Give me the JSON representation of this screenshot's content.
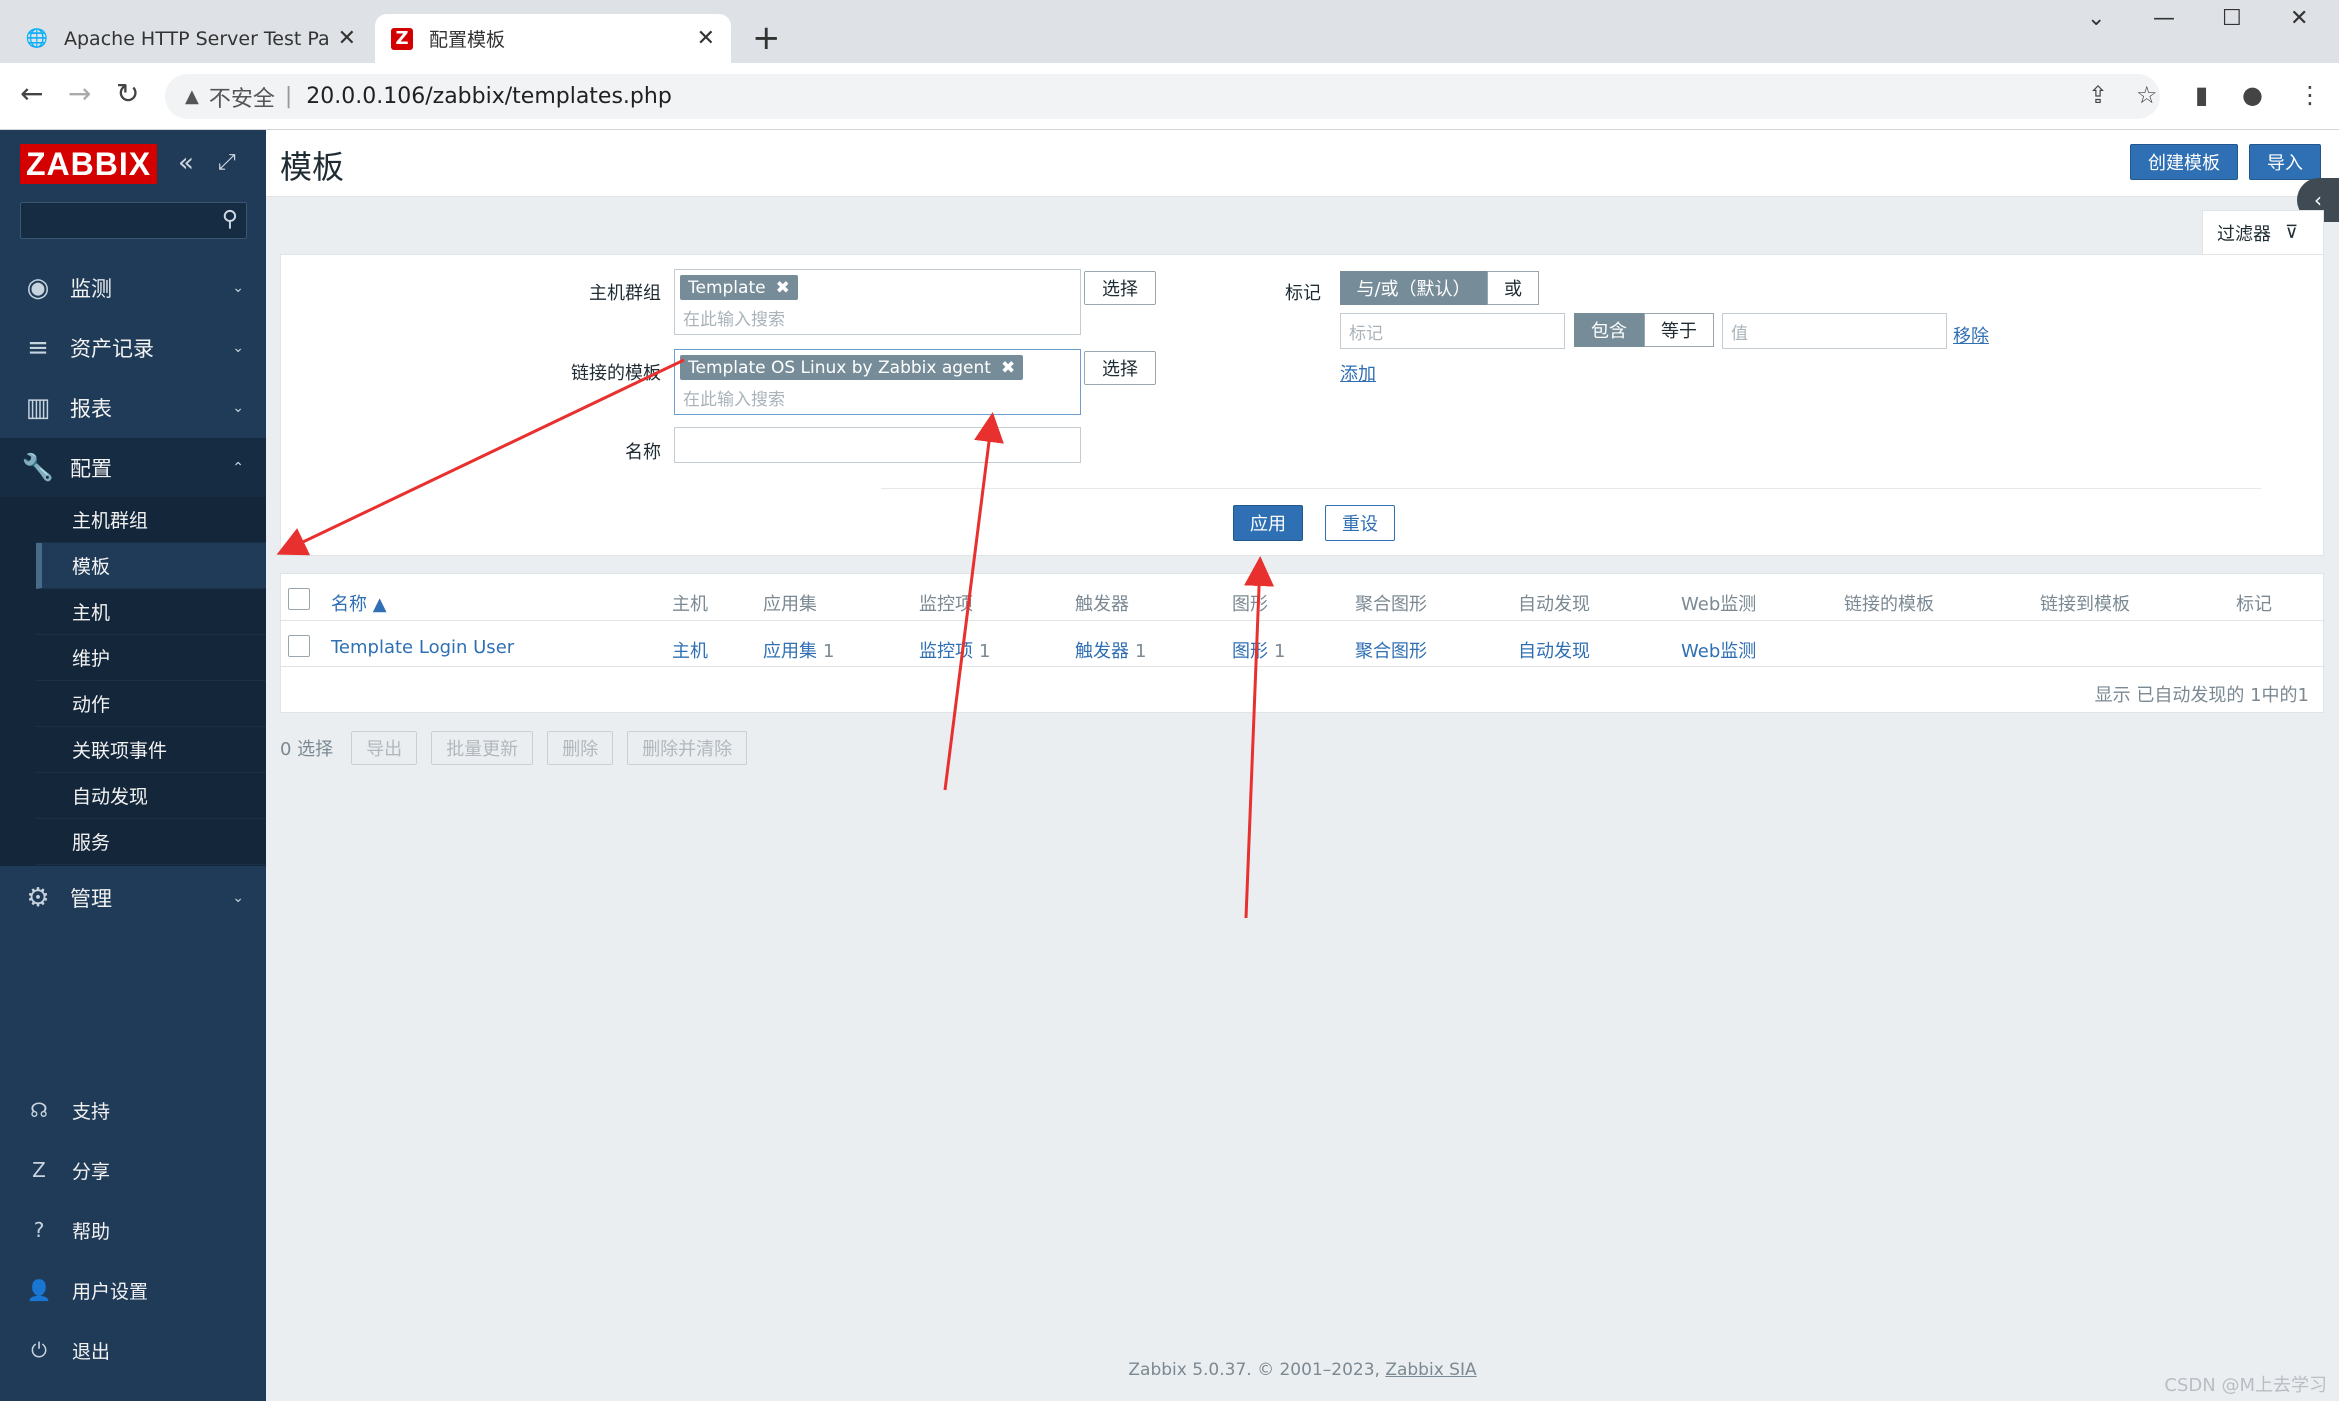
{
  "browser": {
    "tabs": [
      {
        "title": "Apache HTTP Server Test Page",
        "icon": "globe-icon"
      },
      {
        "title": "配置模板",
        "icon": "zabbix-favicon",
        "favicon_letter": "Z"
      }
    ],
    "new_tab": "+",
    "address": {
      "insecure_label": "不安全",
      "separator": "|",
      "url": "20.0.0.106/zabbix/templates.php"
    }
  },
  "sidebar": {
    "logo": "ZABBIX",
    "search_placeholder": "",
    "menu": [
      {
        "label": "监测",
        "icon": "eye-icon"
      },
      {
        "label": "资产记录",
        "icon": "list-icon"
      },
      {
        "label": "报表",
        "icon": "bar-chart-icon"
      },
      {
        "label": "配置",
        "icon": "wrench-icon"
      },
      {
        "label": "管理",
        "icon": "gear-icon"
      }
    ],
    "submenu": [
      "主机群组",
      "模板",
      "主机",
      "维护",
      "动作",
      "关联项事件",
      "自动发现",
      "服务"
    ],
    "footer": [
      {
        "label": "支持",
        "icon": "headset-icon"
      },
      {
        "label": "分享",
        "icon": "share-icon"
      },
      {
        "label": "帮助",
        "icon": "help-icon"
      },
      {
        "label": "用户设置",
        "icon": "user-icon"
      },
      {
        "label": "退出",
        "icon": "power-icon"
      }
    ]
  },
  "page": {
    "title": "模板",
    "create_button": "创建模板",
    "import_button": "导入"
  },
  "filter": {
    "tab_label": "过滤器",
    "host_groups_label": "主机群组",
    "host_groups_chip": "Template",
    "linked_templates_label": "链接的模板",
    "linked_templates_chip": "Template OS Linux by Zabbix agent",
    "search_placeholder": "在此输入搜索",
    "select_button": "选择",
    "name_label": "名称",
    "name_value": "",
    "tags_label": "标记",
    "tag_and_or": "与/或（默认）",
    "tag_or": "或",
    "tag_placeholder": "标记",
    "contains": "包含",
    "equals": "等于",
    "value_placeholder": "值",
    "remove": "移除",
    "add": "添加",
    "apply": "应用",
    "reset": "重设"
  },
  "table": {
    "headers": [
      "名称 ▲",
      "主机",
      "应用集",
      "监控项",
      "触发器",
      "图形",
      "聚合图形",
      "自动发现",
      "Web监测",
      "链接的模板",
      "链接到模板",
      "标记"
    ],
    "row": {
      "name": "Template Login User",
      "hosts": "主机",
      "applications": "应用集",
      "applications_count": "1",
      "items": "监控项",
      "items_count": "1",
      "triggers": "触发器",
      "triggers_count": "1",
      "graphs": "图形",
      "graphs_count": "1",
      "screens": "聚合图形",
      "discovery": "自动发现",
      "web": "Web监测"
    },
    "paging": "显示 已自动发现的 1中的1"
  },
  "actions": {
    "selected": "0 选择",
    "buttons": [
      "导出",
      "批量更新",
      "删除",
      "删除并清除"
    ]
  },
  "footer": {
    "text": "Zabbix 5.0.37. © 2001–2023, ",
    "link": "Zabbix SIA"
  },
  "watermark": "CSDN @M上去学习",
  "colors": {
    "brand": "#d40000",
    "sidebar": "#1f3b57",
    "primary": "#2f6fb3",
    "annotation_arrow": "#e8302e"
  }
}
